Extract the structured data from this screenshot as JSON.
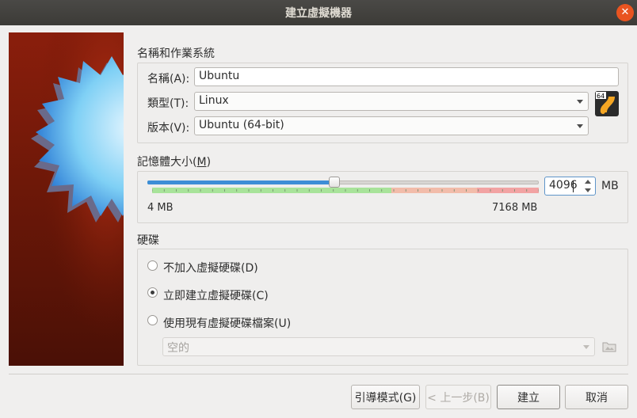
{
  "window": {
    "title": "建立虛擬機器",
    "close_icon": "close-icon"
  },
  "name_os": {
    "title": "名稱和作業系統",
    "name_label": "名稱(A):",
    "name_value": "Ubuntu",
    "type_label": "類型(T):",
    "type_value": "Linux",
    "version_label": "版本(V):",
    "version_value": "Ubuntu (64-bit)",
    "os_badge": "64"
  },
  "memory": {
    "title": "記憶體大小(M)",
    "min_label": "4 MB",
    "max_label": "7168 MB",
    "value": "4096",
    "unit": "MB",
    "slider_min": 4,
    "slider_max": 8192,
    "slider_value": 4096,
    "colors": {
      "green": "#a8e39a",
      "orange": "#f2bcaa",
      "red": "#f2a3a3",
      "accent": "#3d8ed6"
    }
  },
  "disk": {
    "title": "硬碟",
    "options": [
      {
        "label": "不加入虛擬硬碟(D)",
        "checked": false
      },
      {
        "label": "立即建立虛擬硬碟(C)",
        "checked": true
      },
      {
        "label": "使用現有虛擬硬碟檔案(U)",
        "checked": false
      }
    ],
    "file_placeholder": "空的",
    "folder_icon": "folder-icon"
  },
  "buttons": {
    "guided": "引導模式(G)",
    "back": "< 上一步(B)",
    "create": "建立",
    "cancel": "取消"
  }
}
